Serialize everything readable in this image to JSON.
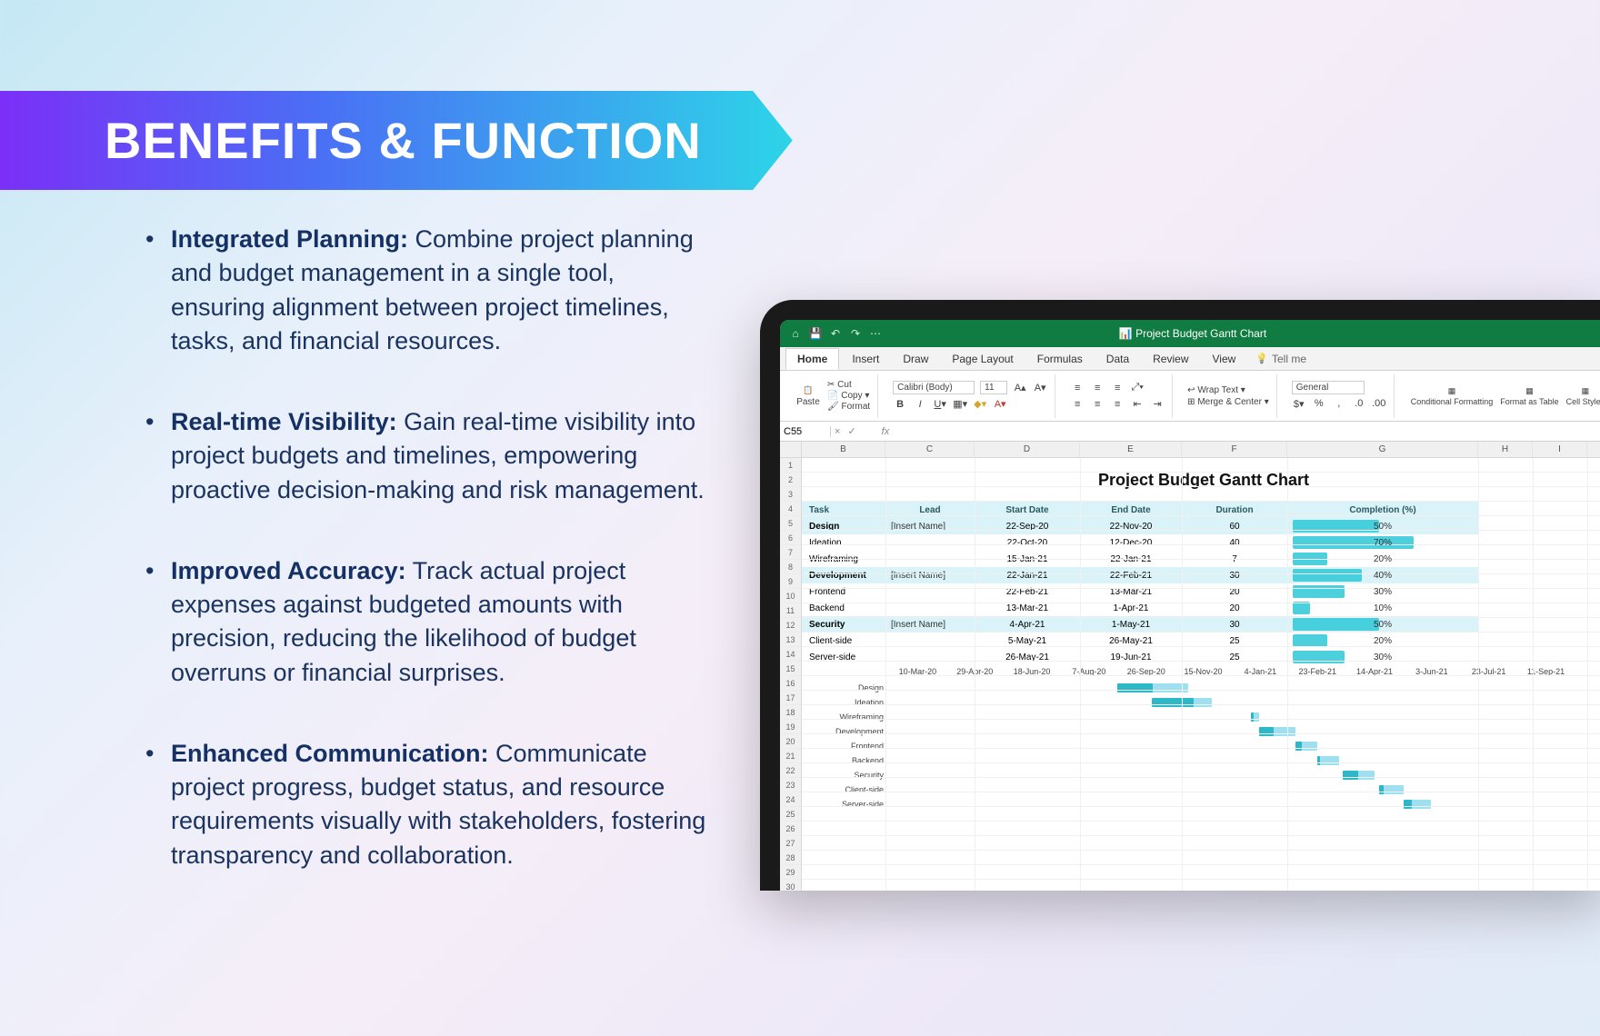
{
  "banner": {
    "title": "BENEFITS & FUNCTION"
  },
  "bullets": [
    {
      "heading": "Integrated Planning:",
      "body": " Combine project planning and budget management in a single tool, ensuring alignment between project timelines, tasks, and financial resources."
    },
    {
      "heading": "Real-time Visibility:",
      "body": " Gain real-time visibility into project budgets and timelines, empowering proactive decision-making and risk management."
    },
    {
      "heading": "Improved Accuracy:",
      "body": " Track actual project expenses against budgeted amounts with precision, reducing the likelihood of budget overruns or financial surprises."
    },
    {
      "heading": "Enhanced Communication:",
      "body": " Communicate project progress, budget status, and resource requirements visually with stakeholders, fostering transparency and collaboration."
    }
  ],
  "excel": {
    "titlebar": "Project Budget Gantt Chart",
    "tabs": [
      "Home",
      "Insert",
      "Draw",
      "Page Layout",
      "Formulas",
      "Data",
      "Review",
      "View"
    ],
    "active_tab": "Home",
    "tellme": "Tell me",
    "ribbon": {
      "paste": "Paste",
      "cut": "Cut",
      "copy": "Copy",
      "format": "Format",
      "font_name": "Calibri (Body)",
      "font_size": "11",
      "wrap": "Wrap Text",
      "merge": "Merge & Center",
      "number_format": "General",
      "cond_fmt": "Conditional Formatting",
      "fmt_table": "Format as Table",
      "cell_styles": "Cell Styles"
    },
    "namebox": "C55",
    "fx": "fx",
    "col_letters": [
      "B",
      "C",
      "D",
      "E",
      "F",
      "G",
      "H",
      "I"
    ],
    "sheet_title": "Project Budget Gantt Chart",
    "headers": [
      "Task",
      "Lead",
      "Start Date",
      "End Date",
      "Duration",
      "Completion (%)"
    ],
    "insert_name": "[Insert Name]",
    "rows": [
      {
        "task": "Design",
        "lead": "[Insert Name]",
        "start": "22-Sep-20",
        "end": "22-Nov-20",
        "duration": "60",
        "completion": 50,
        "section": true
      },
      {
        "task": "Ideation",
        "lead": "",
        "start": "22-Oct-20",
        "end": "12-Dec-20",
        "duration": "40",
        "completion": 70
      },
      {
        "task": "Wireframing",
        "lead": "",
        "start": "15-Jan-21",
        "end": "22-Jan-21",
        "duration": "7",
        "completion": 20
      },
      {
        "task": "Development",
        "lead": "[Insert Name]",
        "start": "22-Jan-21",
        "end": "22-Feb-21",
        "duration": "30",
        "completion": 40,
        "section": true
      },
      {
        "task": "Frontend",
        "lead": "",
        "start": "22-Feb-21",
        "end": "13-Mar-21",
        "duration": "20",
        "completion": 30
      },
      {
        "task": "Backend",
        "lead": "",
        "start": "13-Mar-21",
        "end": "1-Apr-21",
        "duration": "20",
        "completion": 10
      },
      {
        "task": "Security",
        "lead": "[Insert Name]",
        "start": "4-Apr-21",
        "end": "1-May-21",
        "duration": "30",
        "completion": 50,
        "section": true
      },
      {
        "task": "Client-side",
        "lead": "",
        "start": "5-May-21",
        "end": "26-May-21",
        "duration": "25",
        "completion": 20
      },
      {
        "task": "Server-side",
        "lead": "",
        "start": "26-May-21",
        "end": "19-Jun-21",
        "duration": "25",
        "completion": 30
      }
    ],
    "row_numbers_start": 1,
    "row_numbers_count": 34
  },
  "chart_data": {
    "type": "gantt",
    "title": "Project Budget Gantt Chart",
    "x_axis_dates": [
      "10-Mar-20",
      "29-Apr-20",
      "18-Jun-20",
      "7-Aug-20",
      "26-Sep-20",
      "15-Nov-20",
      "4-Jan-21",
      "23-Feb-21",
      "14-Apr-21",
      "3-Jun-21",
      "23-Jul-21",
      "11-Sep-21"
    ],
    "tasks": [
      {
        "name": "Design",
        "start": "22-Sep-20",
        "end": "22-Nov-20",
        "duration": 60,
        "completion": 50
      },
      {
        "name": "Ideation",
        "start": "22-Oct-20",
        "end": "12-Dec-20",
        "duration": 40,
        "completion": 70
      },
      {
        "name": "Wireframing",
        "start": "15-Jan-21",
        "end": "22-Jan-21",
        "duration": 7,
        "completion": 20
      },
      {
        "name": "Development",
        "start": "22-Jan-21",
        "end": "22-Feb-21",
        "duration": 30,
        "completion": 40
      },
      {
        "name": "Frontend",
        "start": "22-Feb-21",
        "end": "13-Mar-21",
        "duration": 20,
        "completion": 30
      },
      {
        "name": "Backend",
        "start": "13-Mar-21",
        "end": "1-Apr-21",
        "duration": 20,
        "completion": 10
      },
      {
        "name": "Security",
        "start": "4-Apr-21",
        "end": "1-May-21",
        "duration": 30,
        "completion": 50
      },
      {
        "name": "Client-side",
        "start": "5-May-21",
        "end": "26-May-21",
        "duration": 25,
        "completion": 20
      },
      {
        "name": "Server-side",
        "start": "26-May-21",
        "end": "19-Jun-21",
        "duration": 25,
        "completion": 30
      }
    ]
  }
}
